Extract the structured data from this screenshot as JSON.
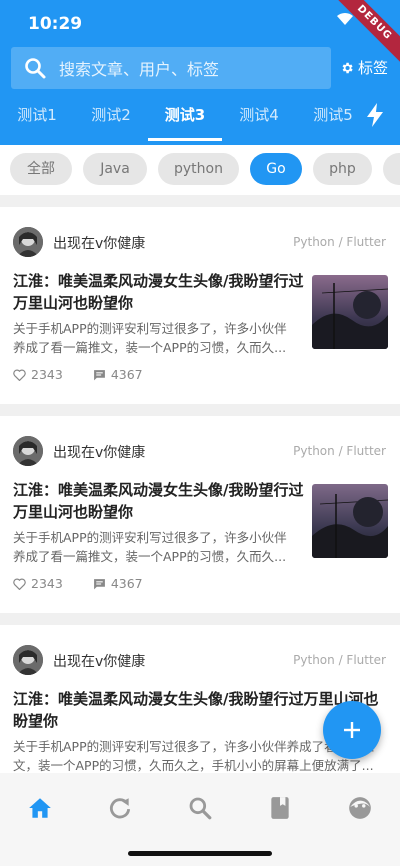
{
  "status": {
    "time": "10:29",
    "debug_label": "DEBUG"
  },
  "search": {
    "placeholder": "搜索文章、用户、标签",
    "icon": "search-icon"
  },
  "tag_button": {
    "label": "标签",
    "icon": "gear-icon"
  },
  "tabs": [
    {
      "label": "测试1",
      "active": false
    },
    {
      "label": "测试2",
      "active": false
    },
    {
      "label": "测试3",
      "active": true
    },
    {
      "label": "测试4",
      "active": false
    },
    {
      "label": "测试5",
      "active": false
    }
  ],
  "chips": [
    {
      "label": "全部",
      "active": false
    },
    {
      "label": "Java",
      "active": false
    },
    {
      "label": "python",
      "active": false
    },
    {
      "label": "Go",
      "active": true
    },
    {
      "label": "php",
      "active": false
    }
  ],
  "articles": [
    {
      "author": "出现在v你健康",
      "category": "Python / Flutter",
      "title_line1": "江淮：唯美温柔风动漫女生头像/我盼望行过",
      "title_line2": "万里山河也盼望你",
      "desc_line1": "关于手机APP的测评安利写过很多了，许多小伙伴",
      "desc_line2": "养成了看一篇推文，装一个APP的习惯，久而久...",
      "likes": "2343",
      "comments": "4367",
      "has_thumb": true
    },
    {
      "author": "出现在v你健康",
      "category": "Python / Flutter",
      "title_line1": "江淮：唯美温柔风动漫女生头像/我盼望行过",
      "title_line2": "万里山河也盼望你",
      "desc_line1": "关于手机APP的测评安利写过很多了，许多小伙伴",
      "desc_line2": "养成了看一篇推文，装一个APP的习惯，久而久...",
      "likes": "2343",
      "comments": "4367",
      "has_thumb": true
    },
    {
      "author": "出现在v你健康",
      "category": "Python / Flutter",
      "title_line1": "江淮：唯美温柔风动漫女生头像/我盼望行过万里山河也",
      "title_line2": "盼望你",
      "desc_line1": "关于手机APP的测评安利写过很多了，许多小伙伴养成了看一篇推",
      "desc_line2": "文，装一个APP的习惯，久而久之，手机小小的屏幕上便放满了...",
      "has_thumb": false
    }
  ],
  "bottom_nav": [
    {
      "icon": "home-icon",
      "active": true
    },
    {
      "icon": "refresh-icon",
      "active": false
    },
    {
      "icon": "search-icon",
      "active": false
    },
    {
      "icon": "book-icon",
      "active": false
    },
    {
      "icon": "face-icon",
      "active": false
    }
  ],
  "colors": {
    "primary": "#2196F3",
    "chip_bg": "#e6e6e6",
    "text_dark": "#222222",
    "text_muted": "#888888"
  }
}
